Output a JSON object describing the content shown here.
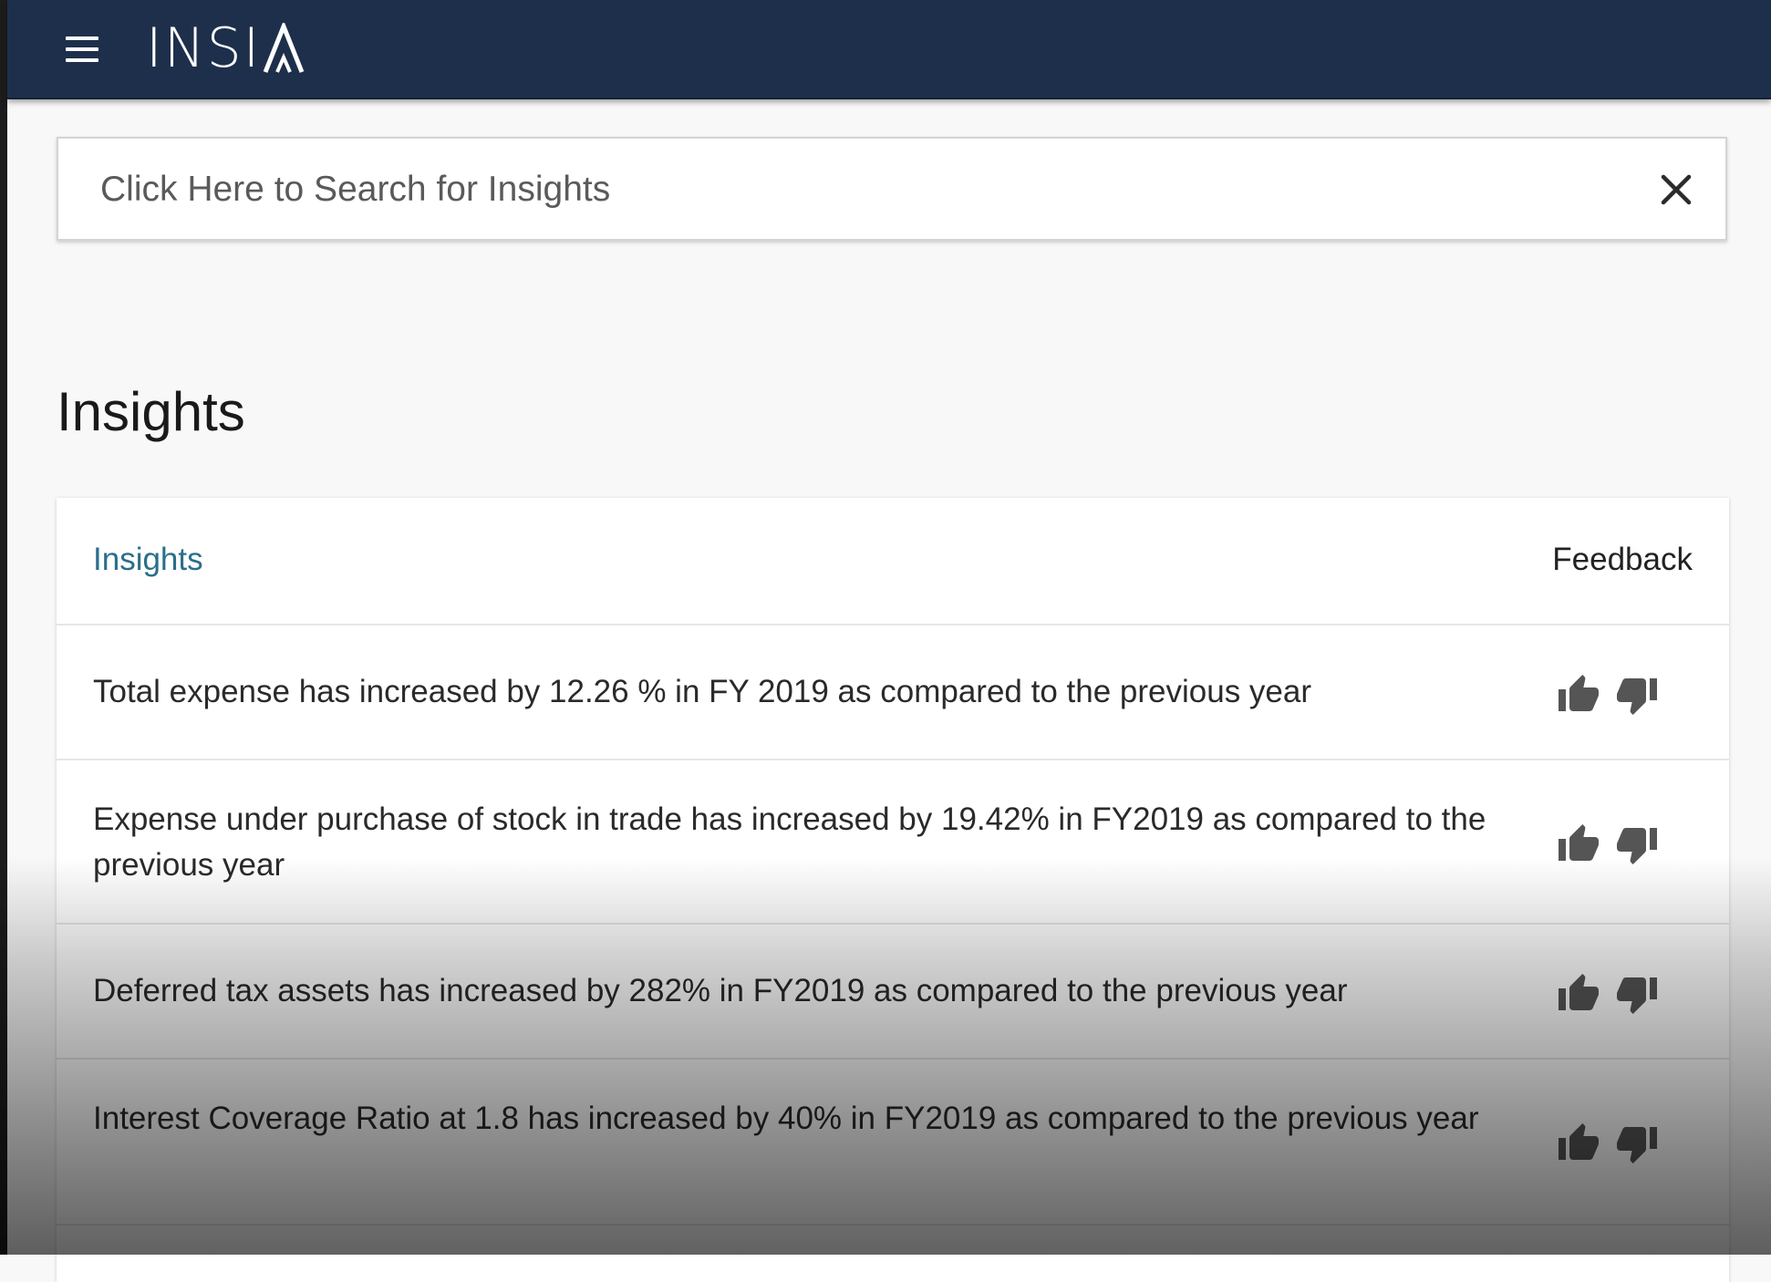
{
  "app": {
    "logo_text": "INSI",
    "logo_last_letter": "A",
    "menu_icon": "hamburger-menu-icon"
  },
  "search": {
    "placeholder": "Click Here to Search for Insights",
    "value": "",
    "clear_icon": "close-icon"
  },
  "page": {
    "title": "Insights"
  },
  "table": {
    "headers": {
      "insights": "Insights",
      "feedback": "Feedback"
    },
    "rows": [
      {
        "text": "Total expense has increased by 12.26 % in FY 2019 as compared to the previous year"
      },
      {
        "text": "Expense under purchase of stock in trade has increased by 19.42% in FY2019 as compared to the previous year"
      },
      {
        "text": "Deferred tax assets has increased by 282% in FY2019 as compared to the previous year"
      },
      {
        "text": "Interest Coverage Ratio at 1.8 has increased by 40% in FY2019 as compared to the previous year"
      }
    ],
    "feedback_icons": [
      "thumbs-up-icon",
      "thumbs-down-icon"
    ]
  },
  "colors": {
    "topbar": "#1e2f4b",
    "header_link": "#2a6f8a",
    "icon": "#555555"
  }
}
